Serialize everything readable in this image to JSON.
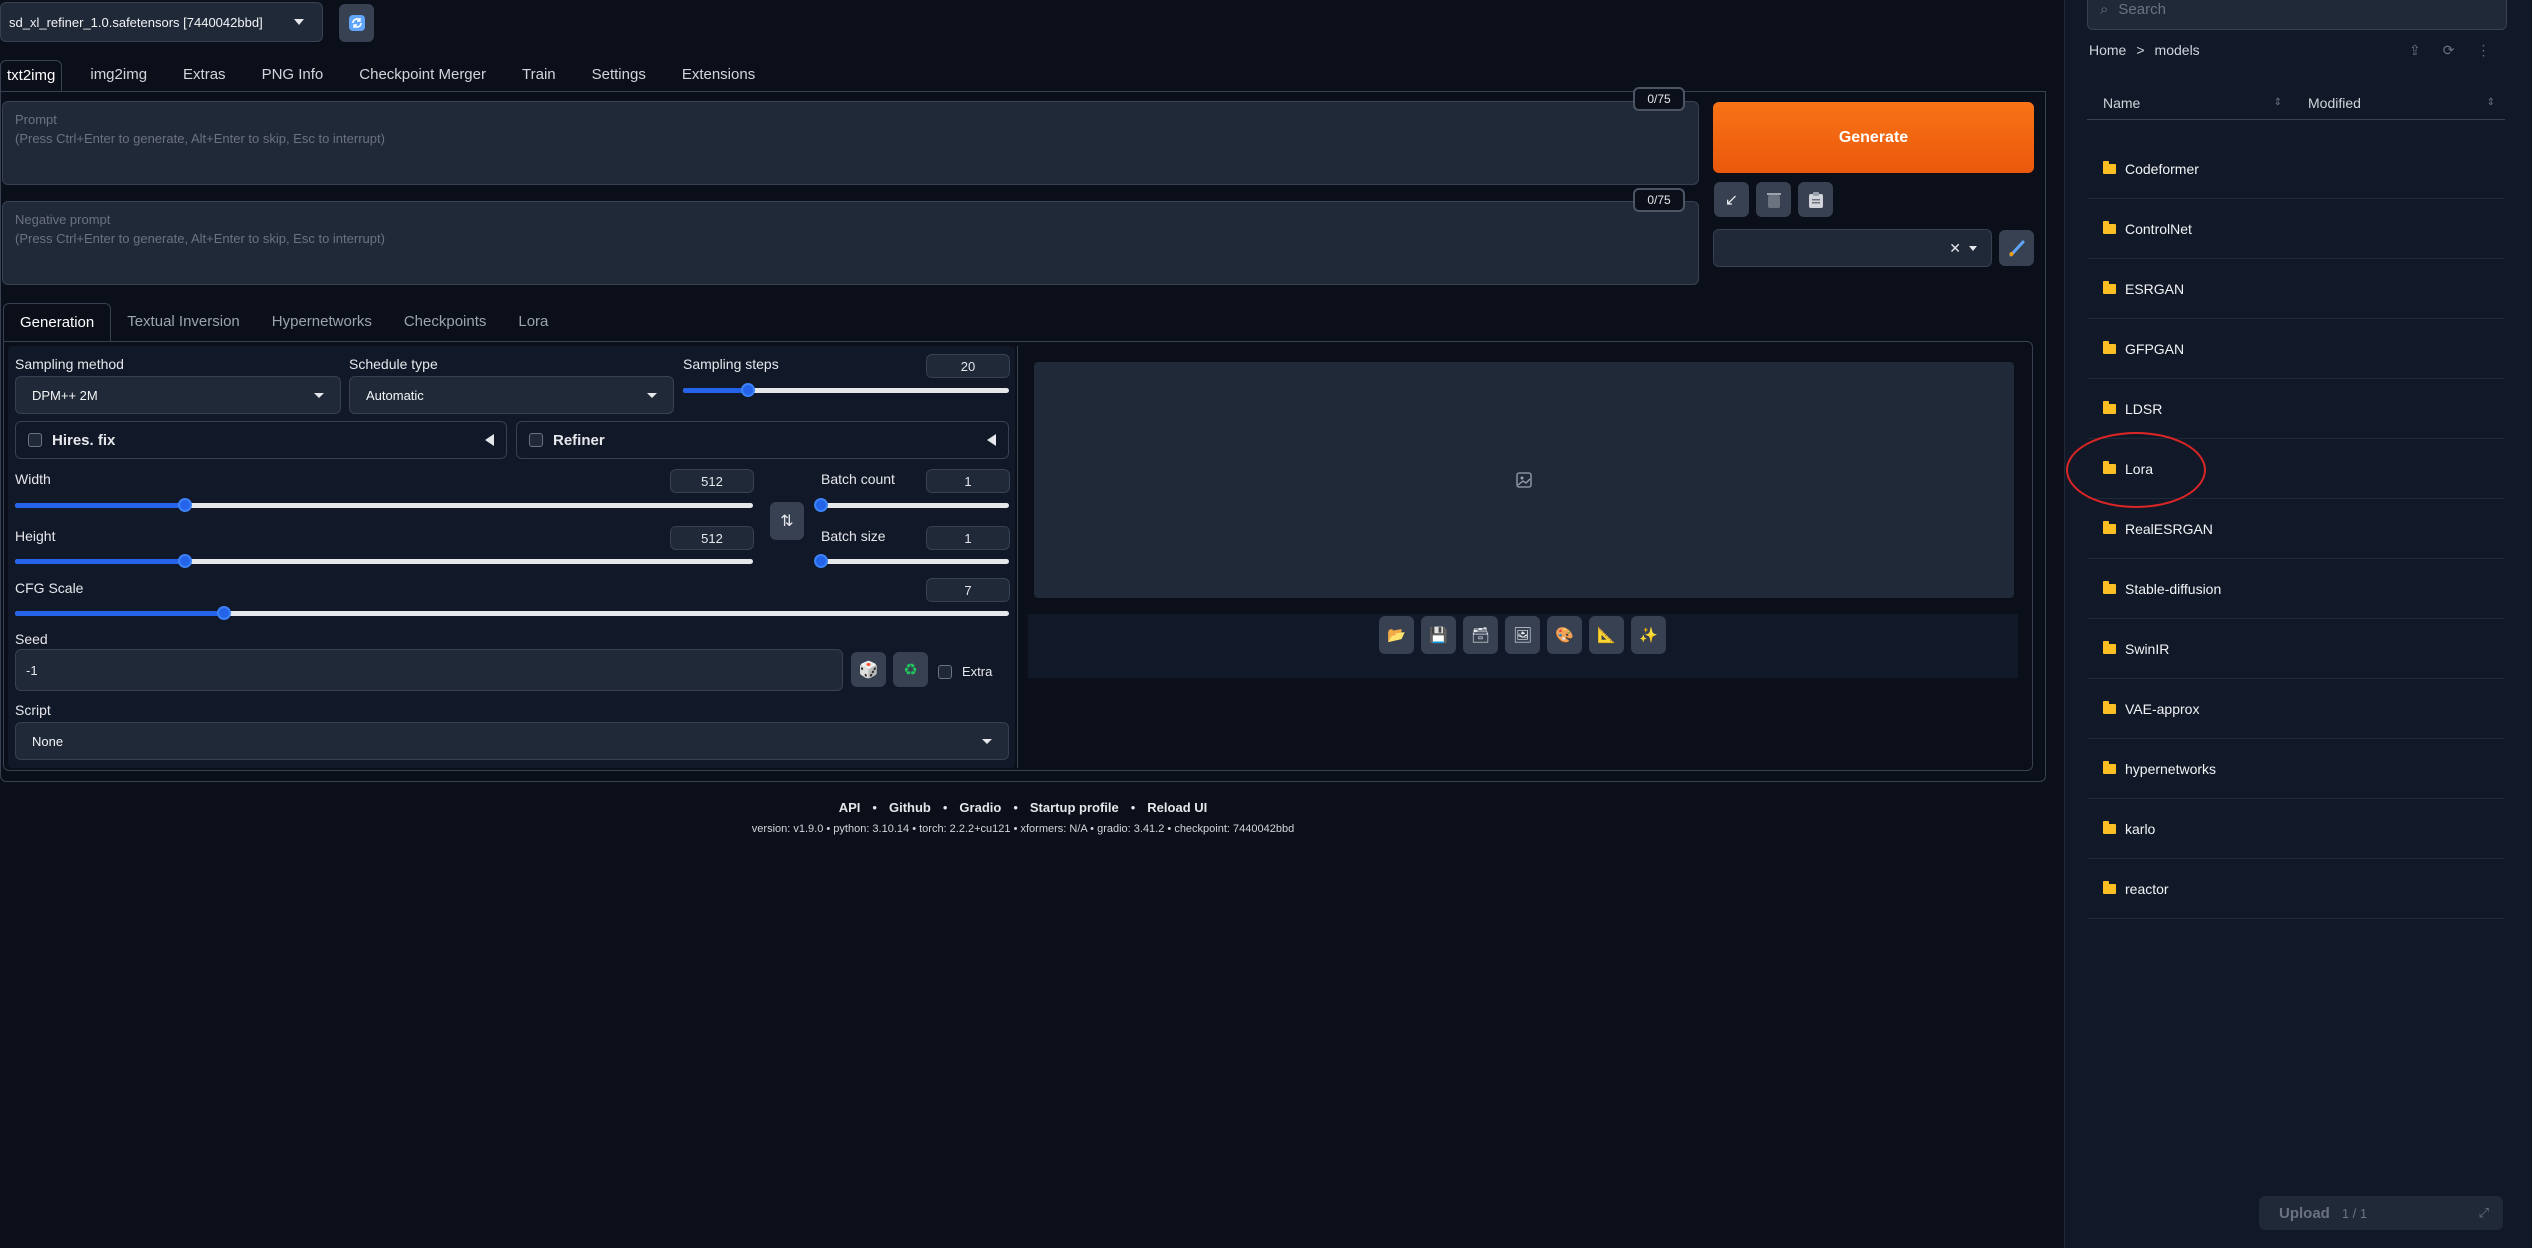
{
  "checkpoint": {
    "value": "sd_xl_refiner_1.0.safetensors [7440042bbd]"
  },
  "top_tabs": [
    "txt2img",
    "img2img",
    "Extras",
    "PNG Info",
    "Checkpoint Merger",
    "Train",
    "Settings",
    "Extensions"
  ],
  "prompt": {
    "title": "Prompt",
    "hint": "(Press Ctrl+Enter to generate, Alt+Enter to skip, Esc to interrupt)",
    "tokens": "0/75"
  },
  "negative_prompt": {
    "title": "Negative prompt",
    "hint": "(Press Ctrl+Enter to generate, Alt+Enter to skip, Esc to interrupt)",
    "tokens": "0/75"
  },
  "generate_label": "Generate",
  "sub_tabs": [
    "Generation",
    "Textual Inversion",
    "Hypernetworks",
    "Checkpoints",
    "Lora"
  ],
  "settings": {
    "sampling_method_label": "Sampling method",
    "sampling_method_value": "DPM++ 2M",
    "schedule_type_label": "Schedule type",
    "schedule_type_value": "Automatic",
    "sampling_steps_label": "Sampling steps",
    "sampling_steps_value": "20",
    "hires_label": "Hires. fix",
    "refiner_label": "Refiner",
    "width_label": "Width",
    "width_value": "512",
    "height_label": "Height",
    "height_value": "512",
    "batch_count_label": "Batch count",
    "batch_count_value": "1",
    "batch_size_label": "Batch size",
    "batch_size_value": "1",
    "cfg_label": "CFG Scale",
    "cfg_value": "7",
    "seed_label": "Seed",
    "seed_value": "-1",
    "extra_label": "Extra",
    "script_label": "Script",
    "script_value": "None"
  },
  "sliders": {
    "sampling_steps": 0.2,
    "width": 0.23,
    "height": 0.23,
    "batch_count": 0.0,
    "batch_size": 0.0,
    "cfg": 0.21
  },
  "footer": {
    "links": [
      "API",
      "Github",
      "Gradio",
      "Startup profile",
      "Reload UI"
    ],
    "version_line": "version: v1.9.0  •  python: 3.10.14  •  torch: 2.2.2+cu121  •  xformers: N/A  •  gradio: 3.41.2  •  checkpoint: 7440042bbd"
  },
  "file_browser": {
    "search_placeholder": "Search",
    "breadcrumb": [
      "Home",
      ">",
      "models"
    ],
    "col_name": "Name",
    "col_modified": "Modified",
    "folders": [
      "Codeformer",
      "ControlNet",
      "ESRGAN",
      "GFPGAN",
      "LDSR",
      "Lora",
      "RealESRGAN",
      "Stable-diffusion",
      "SwinIR",
      "VAE-approx",
      "hypernetworks",
      "karlo",
      "reactor"
    ],
    "upload_label": "Upload",
    "upload_count": "1 / 1"
  },
  "colors": {
    "accent": "#f97316",
    "slider": "#2563eb",
    "background": "#0b0f19",
    "annotation": "#dc2626"
  }
}
